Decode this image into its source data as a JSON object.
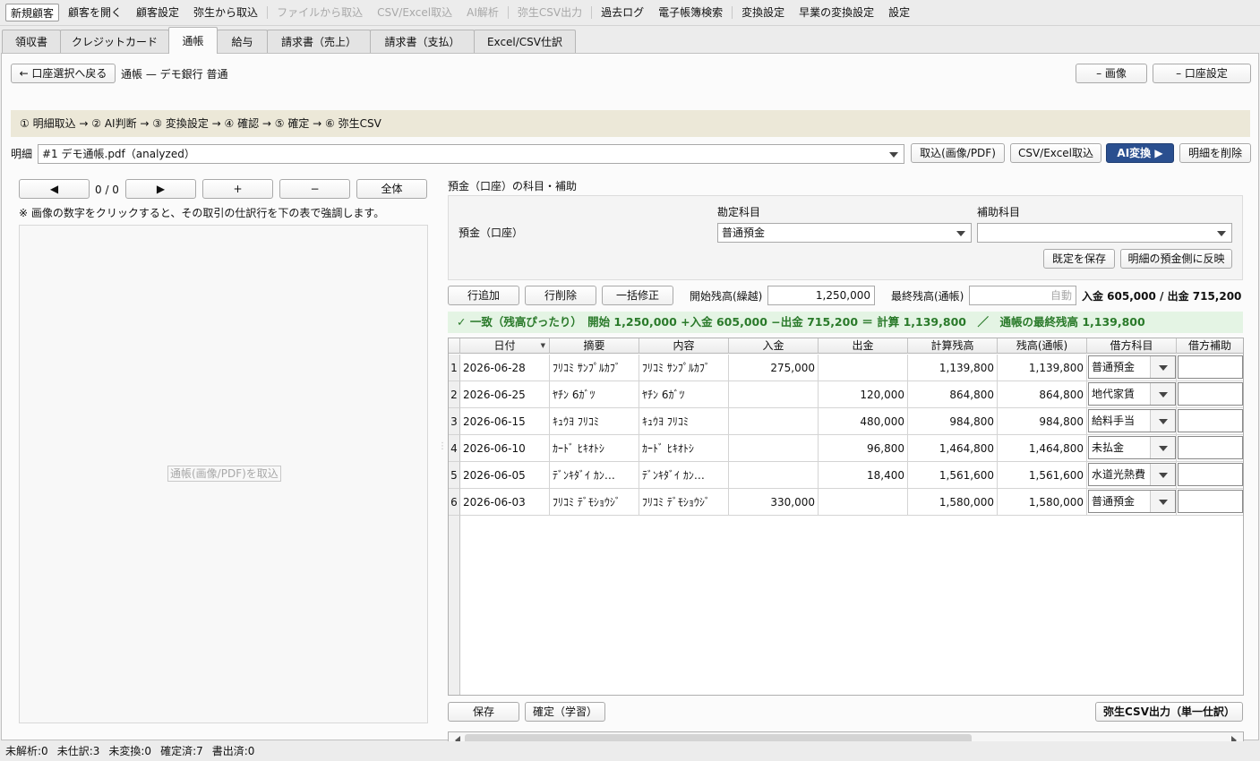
{
  "menu": {
    "items": [
      {
        "label": "新規顧客",
        "enabled": true,
        "boxed": true
      },
      {
        "label": "顧客を開く",
        "enabled": true
      },
      {
        "label": "顧客設定",
        "enabled": true
      },
      {
        "label": "弥生から取込",
        "enabled": true
      },
      {
        "label": "ファイルから取込",
        "enabled": false
      },
      {
        "label": "CSV/Excel取込",
        "enabled": false
      },
      {
        "label": "AI解析",
        "enabled": false
      },
      {
        "label": "弥生CSV出力",
        "enabled": false
      },
      {
        "label": "過去ログ",
        "enabled": true
      },
      {
        "label": "電子帳簿検索",
        "enabled": true
      },
      {
        "label": "変換設定",
        "enabled": true
      },
      {
        "label": "早業の変換設定",
        "enabled": true
      },
      {
        "label": "設定",
        "enabled": true
      }
    ]
  },
  "tabs": [
    {
      "label": "領収書",
      "active": false
    },
    {
      "label": "クレジットカード",
      "active": false
    },
    {
      "label": "通帳",
      "active": true
    },
    {
      "label": "給与",
      "active": false
    },
    {
      "label": "請求書（売上）",
      "active": false
    },
    {
      "label": "請求書（支払）",
      "active": false
    },
    {
      "label": "Excel/CSV仕訳",
      "active": false
    }
  ],
  "header": {
    "back_button": "← 口座選択へ戻る",
    "title": "通帳 — デモ銀行 普通",
    "image_button": "– 画像",
    "account_settings_button": "– 口座設定"
  },
  "steps": "① 明細取込 → ② AI判断 → ③ 変換設定 → ④ 確認 → ⑤ 確定 → ⑥ 弥生CSV",
  "statement": {
    "label": "明細",
    "selected": "#1 デモ通帳.pdf（analyzed）",
    "import_image_button": "取込(画像/PDF)",
    "import_csv_button": "CSV/Excel取込",
    "ai_convert_button": "AI変換 ▶",
    "delete_button": "明細を削除"
  },
  "viewer": {
    "prev_button": "◀",
    "page_counter": "0 / 0",
    "next_button": "▶",
    "zoom_in_button": "+",
    "zoom_out_button": "−",
    "fit_button": "全体",
    "hint": "※ 画像の数字をクリックすると、その取引の仕訳行を下の表で強調します。",
    "placeholder": "通帳(画像/PDF)を取込"
  },
  "deposit": {
    "section_title": "預金（口座）の科目・補助",
    "row_label": "預金（口座）",
    "account_header": "勘定科目",
    "account_value": "普通預金",
    "sub_header": "補助科目",
    "sub_value": "",
    "save_default_button": "既定を保存",
    "apply_button": "明細の預金側に反映"
  },
  "toolbar": {
    "add_row": "行追加",
    "delete_row": "行削除",
    "bulk_edit": "一括修正",
    "opening_label": "開始残高(繰越)",
    "opening_value": "1,250,000",
    "final_label": "最終残高(通帳)",
    "final_placeholder": "自動",
    "totals": "入金 605,000 / 出金 715,200"
  },
  "match": "✓ 一致（残高ぴったり）　開始 1,250,000 +入金 605,000 −出金 715,200 ＝ 計算 1,139,800　／　通帳の最終残高 1,139,800",
  "table": {
    "columns": [
      "日付",
      "摘要",
      "内容",
      "入金",
      "出金",
      "計算残高",
      "残高(通帳)",
      "借方科目",
      "借方補助"
    ],
    "rows": [
      {
        "no": "1",
        "date": "2026-06-28",
        "summary": "ﾌﾘｺﾐ ｻﾝﾌﾟﾙｶﾌﾞ",
        "content": "ﾌﾘｺﾐ ｻﾝﾌﾟﾙｶﾌﾞ",
        "deposit": "275,000",
        "withdraw": "",
        "calc": "1,139,800",
        "balance": "1,139,800",
        "debit": "普通預金",
        "debit_sub": ""
      },
      {
        "no": "2",
        "date": "2026-06-25",
        "summary": "ﾔﾁﾝ 6ｶﾞﾂ",
        "content": "ﾔﾁﾝ 6ｶﾞﾂ",
        "deposit": "",
        "withdraw": "120,000",
        "calc": "864,800",
        "balance": "864,800",
        "debit": "地代家賃",
        "debit_sub": ""
      },
      {
        "no": "3",
        "date": "2026-06-15",
        "summary": "ｷｭｳﾖ ﾌﾘｺﾐ",
        "content": "ｷｭｳﾖ ﾌﾘｺﾐ",
        "deposit": "",
        "withdraw": "480,000",
        "calc": "984,800",
        "balance": "984,800",
        "debit": "給料手当",
        "debit_sub": ""
      },
      {
        "no": "4",
        "date": "2026-06-10",
        "summary": "ｶｰﾄﾞ ﾋｷｵﾄｼ",
        "content": "ｶｰﾄﾞ ﾋｷｵﾄｼ",
        "deposit": "",
        "withdraw": "96,800",
        "calc": "1,464,800",
        "balance": "1,464,800",
        "debit": "未払金",
        "debit_sub": ""
      },
      {
        "no": "5",
        "date": "2026-06-05",
        "summary": "ﾃﾞﾝｷﾀﾞｲ ｶﾝ…",
        "content": "ﾃﾞﾝｷﾀﾞｲ ｶﾝ…",
        "deposit": "",
        "withdraw": "18,400",
        "calc": "1,561,600",
        "balance": "1,561,600",
        "debit": "水道光熱費",
        "debit_sub": ""
      },
      {
        "no": "6",
        "date": "2026-06-03",
        "summary": "ﾌﾘｺﾐ ﾃﾞﾓｼｮｳｼﾞ",
        "content": "ﾌﾘｺﾐ ﾃﾞﾓｼｮｳｼﾞ",
        "deposit": "330,000",
        "withdraw": "",
        "calc": "1,580,000",
        "balance": "1,580,000",
        "debit": "普通預金",
        "debit_sub": ""
      }
    ]
  },
  "footer": {
    "save_button": "保存",
    "confirm_button": "確定（学習）",
    "export_button": "弥生CSV出力（単一仕訳）"
  },
  "status": [
    "未解析:0",
    "未仕訳:3",
    "未変換:0",
    "確定済:7",
    "書出済:0"
  ],
  "colors": {
    "accent": "#2a4f8f",
    "steps_bg": "#ece8d8",
    "match_bg": "#e4f4e4",
    "match_text": "#2a7a2a"
  }
}
